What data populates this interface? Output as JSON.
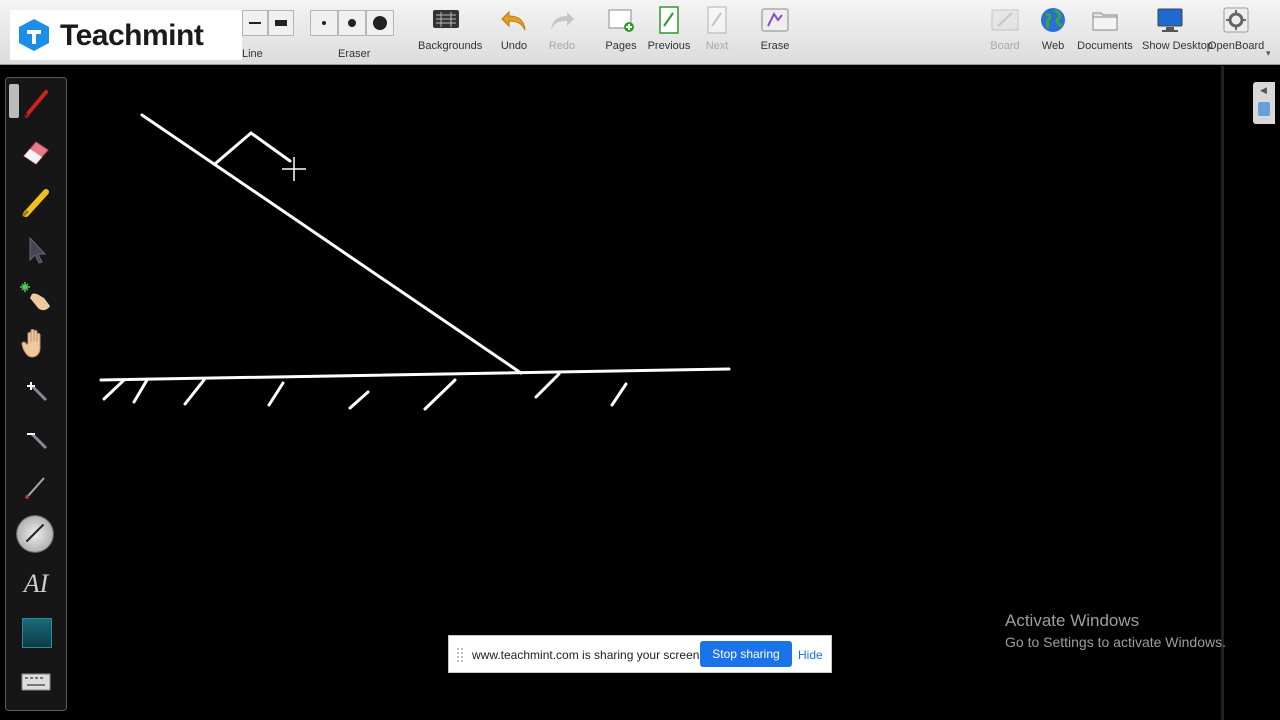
{
  "brand": {
    "name": "Teachmint",
    "color": "#1b8fe8"
  },
  "toolbar": {
    "line_label": "Line",
    "eraser_label": "Eraser",
    "buttons": [
      {
        "label": "Backgrounds",
        "icon": "backgrounds-icon",
        "enabled": true
      },
      {
        "label": "Undo",
        "icon": "undo-icon",
        "enabled": true
      },
      {
        "label": "Redo",
        "icon": "redo-icon",
        "enabled": false
      },
      {
        "label": "Pages",
        "icon": "pages-icon",
        "enabled": true
      },
      {
        "label": "Previous",
        "icon": "previous-icon",
        "enabled": true
      },
      {
        "label": "Next",
        "icon": "next-icon",
        "enabled": false
      },
      {
        "label": "Erase",
        "icon": "erase-icon",
        "enabled": true
      },
      {
        "label": "Board",
        "icon": "board-icon",
        "enabled": false
      },
      {
        "label": "Web",
        "icon": "web-globe-icon",
        "enabled": true
      },
      {
        "label": "Documents",
        "icon": "documents-folder-icon",
        "enabled": true
      },
      {
        "label": "Show Desktop",
        "icon": "desktop-monitor-icon",
        "enabled": true
      },
      {
        "label": "OpenBoard",
        "icon": "gear-icon",
        "enabled": true
      }
    ]
  },
  "left_tools": [
    "pen-icon",
    "eraser-icon",
    "highlighter-icon",
    "pointer-icon",
    "laser-hand-icon",
    "hand-icon",
    "zoom-in-icon",
    "zoom-out-icon",
    "pipette-icon",
    "line-tool-icon",
    "text-tool-icon",
    "capture-icon",
    "keyboard-icon"
  ],
  "watermark": {
    "title": "Activate Windows",
    "subtitle": "Go to Settings to activate Windows."
  },
  "sharebar": {
    "message": "www.teachmint.com is sharing your screen.",
    "stop_label": "Stop sharing",
    "hide_label": "Hide"
  },
  "colors": {
    "canvas": "#000000",
    "ink": "#ffffff",
    "accent": "#1a73e8"
  }
}
